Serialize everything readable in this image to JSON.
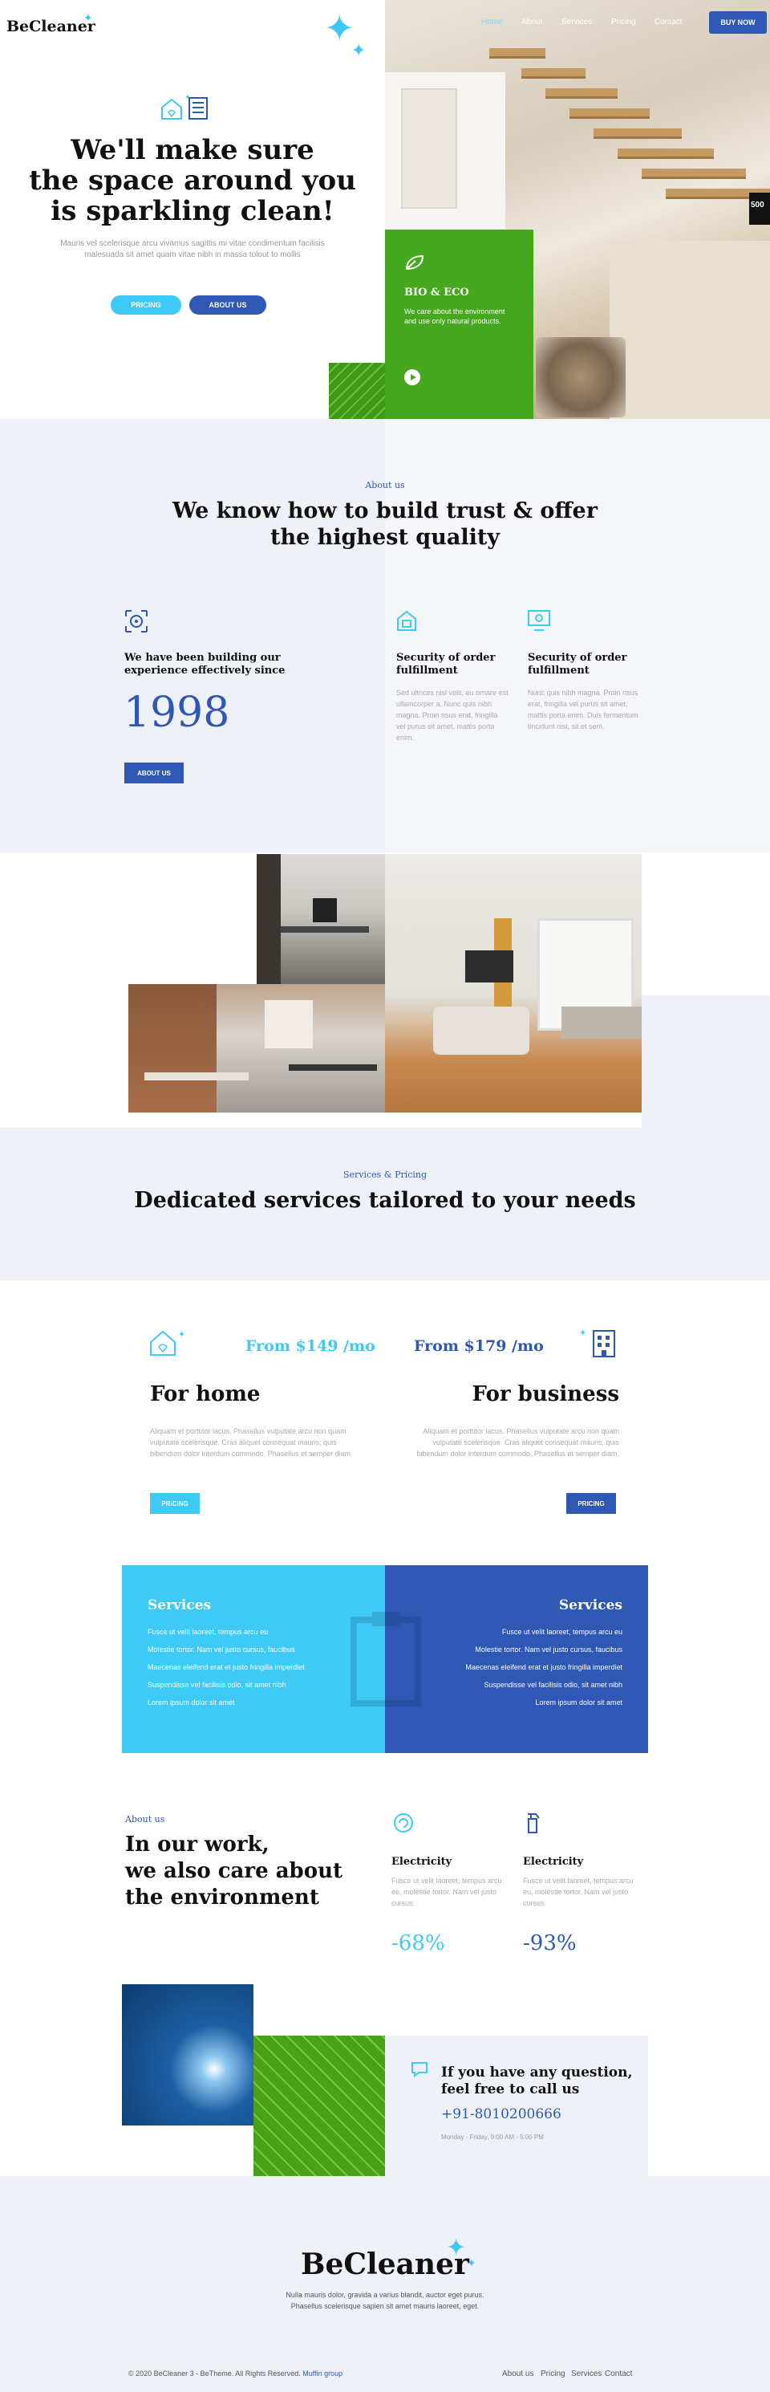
{
  "header": {
    "logo": "BeCleaner",
    "nav": [
      "Home",
      "About",
      "Services",
      "Pricing",
      "Contact"
    ],
    "buy_now": "BUY NOW"
  },
  "hero": {
    "title_lines": [
      "We'll make sure",
      "the space around you",
      "is sparkling clean!"
    ],
    "subtitle": "Mauris vel scelerisque arcu vivamus sagittis mi vitae condimentum facilisis malesuada sit amet quam vitae nibh in massa tolout to mollis",
    "btn_pricing": "PRICING",
    "btn_about": "ABOUT US",
    "card_title": "BIO & ECO",
    "card_text": "We care about the environment and use only natural products.",
    "side_tag": "500"
  },
  "about": {
    "kicker": "About us",
    "title_lines": [
      "We know how to build trust & offer",
      "the highest quality"
    ],
    "feature1_title": "We have been building our experience effectively since",
    "year": "1998",
    "about_btn": "ABOUT US",
    "feature2_title": "Security of order fulfillment",
    "feature2_text": "Sed ultrices nisl velit, eu ornare est ullamcorper a. Nunc quis nibh magna. Proin risus erat, fringilla vel purus sit amet, mattis porta enim.",
    "feature3_title": "Security of order fulfillment",
    "feature3_text": "Nunc quis nibh magna. Proin risus erat, fringilla vel purus sit amet, mattis porta enim. Duis fermentum tincidunt nisi, sit et sem."
  },
  "services": {
    "kicker": "Services & Pricing",
    "title": "Dedicated services tailored to your needs",
    "home_price": "From $149 /mo",
    "home_title": "For home",
    "home_text": "Aliquam et porttitor lacus. Phasellus vulputate arcu non quam vulputate scelerisque. Cras aliquet consequat mauris, quis bibendum dolor interdum commodo. Phasellus et semper diam.",
    "home_btn": "PRICING",
    "business_price": "From $179 /mo",
    "business_title": "For business",
    "business_text": "Aliquam et porttitor lacus. Phasellus vulputate arcu non quam vulputate scelerisque. Cras aliquet consequat mauris, quis bibendum dolor interdum commodo. Phasellus et semper diam.",
    "business_btn": "PRICING",
    "box_title": "Services",
    "box_items": [
      "Fusce ut velit laoreet, tempus arcu eu",
      "Molestie tortor. Nam vel justo cursus, faucibus",
      "Maecenas eleifend erat et justo fringilla imperdiet",
      "Suspendisse vel facilisis odio, sit amet nibh",
      "Lorem ipsum dolor sit amet"
    ]
  },
  "environment": {
    "kicker": "About us",
    "title_lines": [
      "In our work,",
      "we also care about",
      "the environment"
    ],
    "stat1_title": "Electricity",
    "stat1_text": "Fusce ut velit laoreet, tempus arcu eu, molestie tortor. Nam vel justo cursus.",
    "stat1_value": "-68%",
    "stat2_title": "Electricity",
    "stat2_text": "Fusce ut velit laoreet, tempus arcu eu, molestie tortor. Nam vel justo cursus.",
    "stat2_value": "-93%"
  },
  "contact": {
    "title_lines": [
      "If you have any question,",
      "feel free to call us"
    ],
    "phone": "+91-8010200666",
    "hours": "Monday - Friday, 9:00 AM - 5:00 PM"
  },
  "footer": {
    "logo": "BeCleaner",
    "text_lines": [
      "Nulla mauris dolor, gravida a varius blandit, auctor eget purus.",
      "Phasellus scelerisque sapien sit amet mauris laoreet, eget."
    ],
    "copyright": "© 2020 BeCleaner 3 - BeTheme. All Rights Reserved.",
    "credit": "Muffin group",
    "links": [
      "About us",
      "Pricing",
      "Services",
      "Contact"
    ]
  },
  "colors": {
    "accent_light": "#3fcaf5",
    "accent_dark": "#2e58b4",
    "green": "#46a81e",
    "bg_light": "#eef2f8"
  }
}
